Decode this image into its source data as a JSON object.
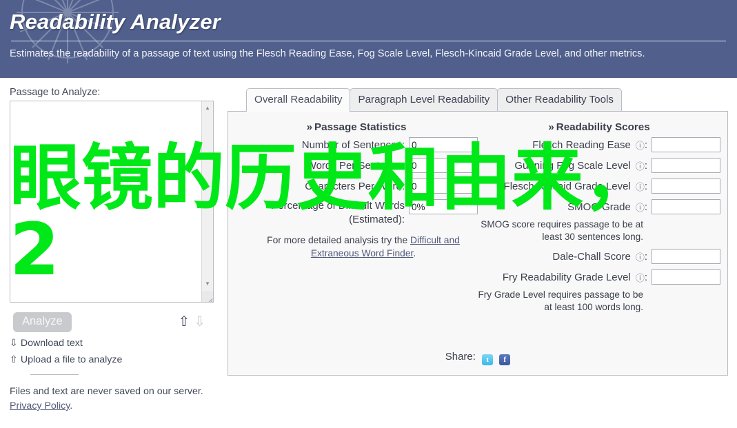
{
  "header": {
    "title": "Readability Analyzer",
    "description": "Estimates the readability of a passage of text using the Flesch Reading Ease, Fog Scale Level, Flesch-Kincaid Grade Level, and other metrics.",
    "bg_color": "#505f8c",
    "logo_icon": "sunburst-icon"
  },
  "left": {
    "passage_label": "Passage to Analyze:",
    "textarea_value": "",
    "analyze_label": "Analyze",
    "scroll_up_icon": "scroll-up-arrow-icon",
    "scroll_down_icon": "scroll-down-arrow-icon",
    "resize_grip_icon": "resize-grip-icon",
    "nav_up_icon": "⇧",
    "nav_down_icon": "⇩",
    "download_glyph": "⇩",
    "download_label": "Download text",
    "upload_glyph": "⇧",
    "upload_label": "Upload a file to analyze",
    "privacy_note": "Files and text are never saved on our server.",
    "privacy_link": "Privacy Policy",
    "privacy_period": "."
  },
  "tabs": [
    {
      "label": "Overall Readability",
      "active": true
    },
    {
      "label": "Paragraph Level Readability",
      "active": false
    },
    {
      "label": "Other Readability Tools",
      "active": false
    }
  ],
  "statistics": {
    "heading_chevron": "»",
    "heading": "Passage Statistics",
    "rows": [
      {
        "label": "Number of Sentences:",
        "value": "0"
      },
      {
        "label": "Words Per Sentence:",
        "value": "0"
      },
      {
        "label": "Characters Per Word:",
        "value": "0"
      }
    ],
    "difficult_label_line1": "Percentage of Difficult Words",
    "difficult_label_line2": "(Estimated):",
    "difficult_value": "0%",
    "detail_note": "For more detailed analysis try the",
    "detail_link": "Difficult and Extraneous Word Finder",
    "detail_period": "."
  },
  "scores": {
    "heading_chevron": "»",
    "heading": "Readability Scores",
    "help_icon": "?",
    "rows": [
      {
        "label": "Flesch Reading Ease",
        "value": "",
        "note": ""
      },
      {
        "label": "Gunning Fog Scale Level",
        "value": "",
        "note": ""
      },
      {
        "label": "Flesch-Kincaid Grade Level",
        "value": "",
        "note": ""
      },
      {
        "label": "SMOG Grade",
        "value": "",
        "note": "SMOG score requires passage to be at least 30 sentences long."
      },
      {
        "label": "Dale-Chall Score",
        "value": "",
        "note": ""
      },
      {
        "label": "Fry Readability Grade Level",
        "value": "",
        "note": "Fry Grade Level requires passage to be at least 100 words long."
      }
    ]
  },
  "share": {
    "label": "Share:",
    "twitter_icon": "twitter-icon",
    "twitter_glyph": "t",
    "facebook_icon": "facebook-icon",
    "facebook_glyph": "f"
  },
  "overlay": {
    "text": "眼镜的历史和由来，\n2",
    "color": "#00e818"
  }
}
